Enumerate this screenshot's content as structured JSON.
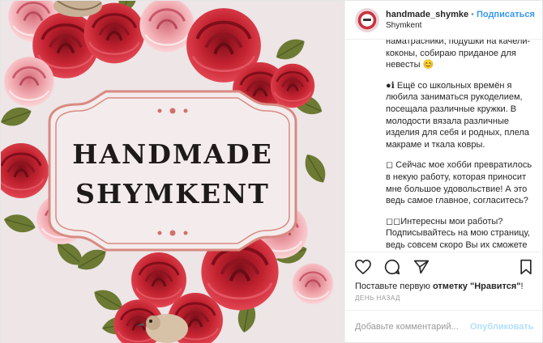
{
  "media": {
    "brand_line1": "HANDMADE",
    "brand_line2": "SHYMKENT",
    "colors": {
      "background": "#ede5e6",
      "rose_red": "#c2222f",
      "rose_pink": "#f1aab0",
      "leaf": "#6c7a33",
      "frame": "#d88a82"
    }
  },
  "header": {
    "username": "handmade_shymke",
    "separator": "•",
    "follow_label": "Подписаться",
    "location": "Shymkent",
    "avatar_icon": "avatar-logo"
  },
  "caption": {
    "p1": "наматрасники, подушки на качели-коконы, собираю приданое для невесты 😊",
    "p2": "●ℹ Ещё со школьных времён я любила заниматься рукоделием, посещала различные кружки. В молодости вязала различные изделия для себя и родных, плела макраме и ткала ковры.",
    "p3": "◻ Сейчас мое хобби превратилось в некую работу, которая приносит мне большое удовольствие! А это ведь самое главное, согласитесь?",
    "p4": "◻◻Интересны мои работы? Подписывайтесь на мою страницу, ведь совсем скоро Вы их сможете"
  },
  "actions": {
    "icons": [
      "heart-icon",
      "comment-icon",
      "share-icon",
      "bookmark-icon"
    ]
  },
  "likes": {
    "prefix": "Поставьте первую ",
    "bold": "отметку \"Нравится\"",
    "suffix": "!"
  },
  "time": "День назад",
  "comment": {
    "placeholder": "Добавьте комментарий...",
    "publish_label": "Опубликовать"
  }
}
